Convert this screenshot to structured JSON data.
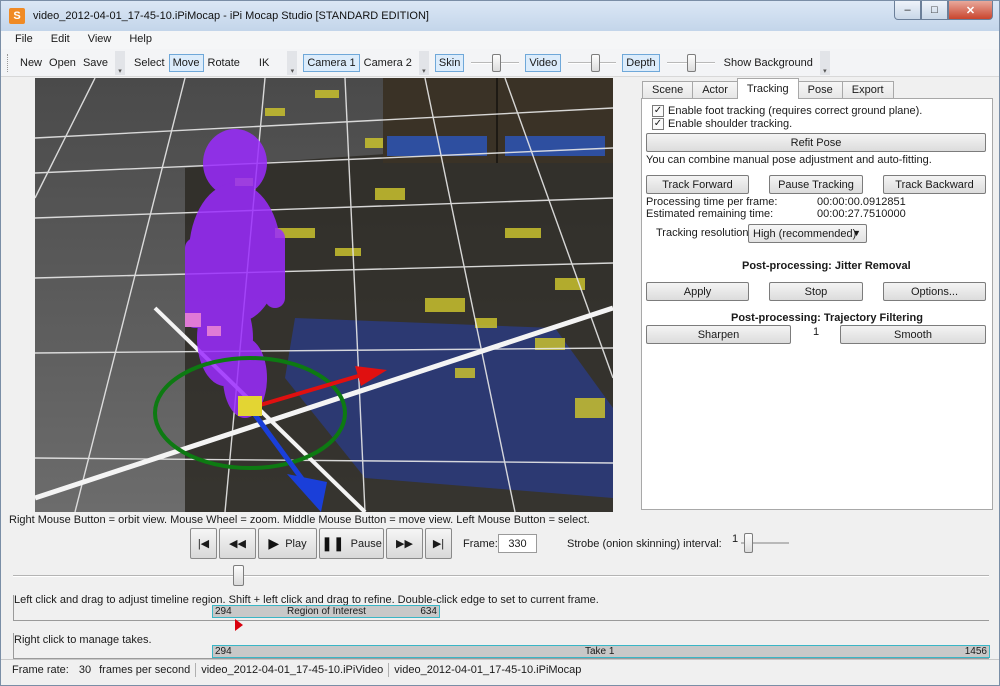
{
  "window": {
    "title": "video_2012-04-01_17-45-10.iPiMocap - iPi Mocap Studio [STANDARD EDITION]",
    "app_icon_glyph": "S",
    "minimize_glyph": "–",
    "maximize_glyph": "□",
    "close_glyph": "✕"
  },
  "menu": [
    "File",
    "Edit",
    "View",
    "Help"
  ],
  "toolbar": {
    "file_group": [
      "New",
      "Open",
      "Save"
    ],
    "select": "Select",
    "move": "Move",
    "rotate": "Rotate",
    "ik": "IK",
    "camera1": "Camera 1",
    "camera2": "Camera 2",
    "skin": "Skin",
    "video": "Video",
    "depth": "Depth",
    "show_background": "Show Background",
    "skin_slider_level": 0.55,
    "video_slider_level": 0.6,
    "depth_slider_level": 0.5
  },
  "viewport": {
    "hint": "Right Mouse Button = orbit view. Mouse Wheel = zoom. Middle Mouse Button = move view. Left Mouse Button = select."
  },
  "tabs": [
    "Scene",
    "Actor",
    "Tracking",
    "Pose",
    "Export"
  ],
  "active_tab": "Tracking",
  "tracking": {
    "foot_tracking": "Enable foot tracking (requires correct ground plane).",
    "shoulder_tracking": "Enable shoulder tracking.",
    "check_glyph": "✓",
    "refit_pose": "Refit Pose",
    "combine_note": "You can combine manual pose adjustment and auto-fitting.",
    "track_forward": "Track Forward",
    "pause_tracking": "Pause Tracking",
    "track_backward": "Track Backward",
    "processing_time_label": "Processing time per frame:",
    "processing_time_value": "00:00:00.0912851",
    "remaining_time_label": "Estimated remaining time:",
    "remaining_time_value": "00:00:27.7510000",
    "resolution_label": "Tracking resolution:",
    "resolution_value": "High (recommended)",
    "jitter_title": "Post-processing: Jitter Removal",
    "apply": "Apply",
    "stop": "Stop",
    "options": "Options...",
    "trajectory_title": "Post-processing: Trajectory Filtering",
    "sharpen": "Sharpen",
    "filter_value": "1",
    "smooth": "Smooth"
  },
  "playback": {
    "play": "Play",
    "pause": "Pause",
    "frame_label": "Frame:",
    "frame_value": "330",
    "strobe_label": "Strobe (onion skinning) interval:",
    "strobe_value": "1",
    "first_glyph": "|◀",
    "prev_glyph": "◀◀",
    "play_glyph": "▶",
    "pause_glyph": "❚❚",
    "next_glyph": "▶▶",
    "last_glyph": "▶|",
    "slider_position": 0.228
  },
  "timeline": {
    "region_hint": "Left click and drag to adjust timeline region. Shift + left click and drag to refine. Double-click edge to set to current frame.",
    "roi_start": "294",
    "roi_label": "Region of Interest",
    "roi_end": "634",
    "takes_hint": "Right click to manage takes.",
    "take_start": "294",
    "take_label": "Take 1",
    "take_end": "1456"
  },
  "statusbar": {
    "frame_rate_label": "Frame rate:",
    "frame_rate_value": "30",
    "frame_rate_unit": "frames per second",
    "video_file": "video_2012-04-01_17-45-10.iPiVideo",
    "project_file": "video_2012-04-01_17-45-10.iPiMocap"
  },
  "colors": {
    "accent_blue": "#39b6c6",
    "marker_red": "#d9000d",
    "skeleton_purple": "#9b2bff"
  }
}
